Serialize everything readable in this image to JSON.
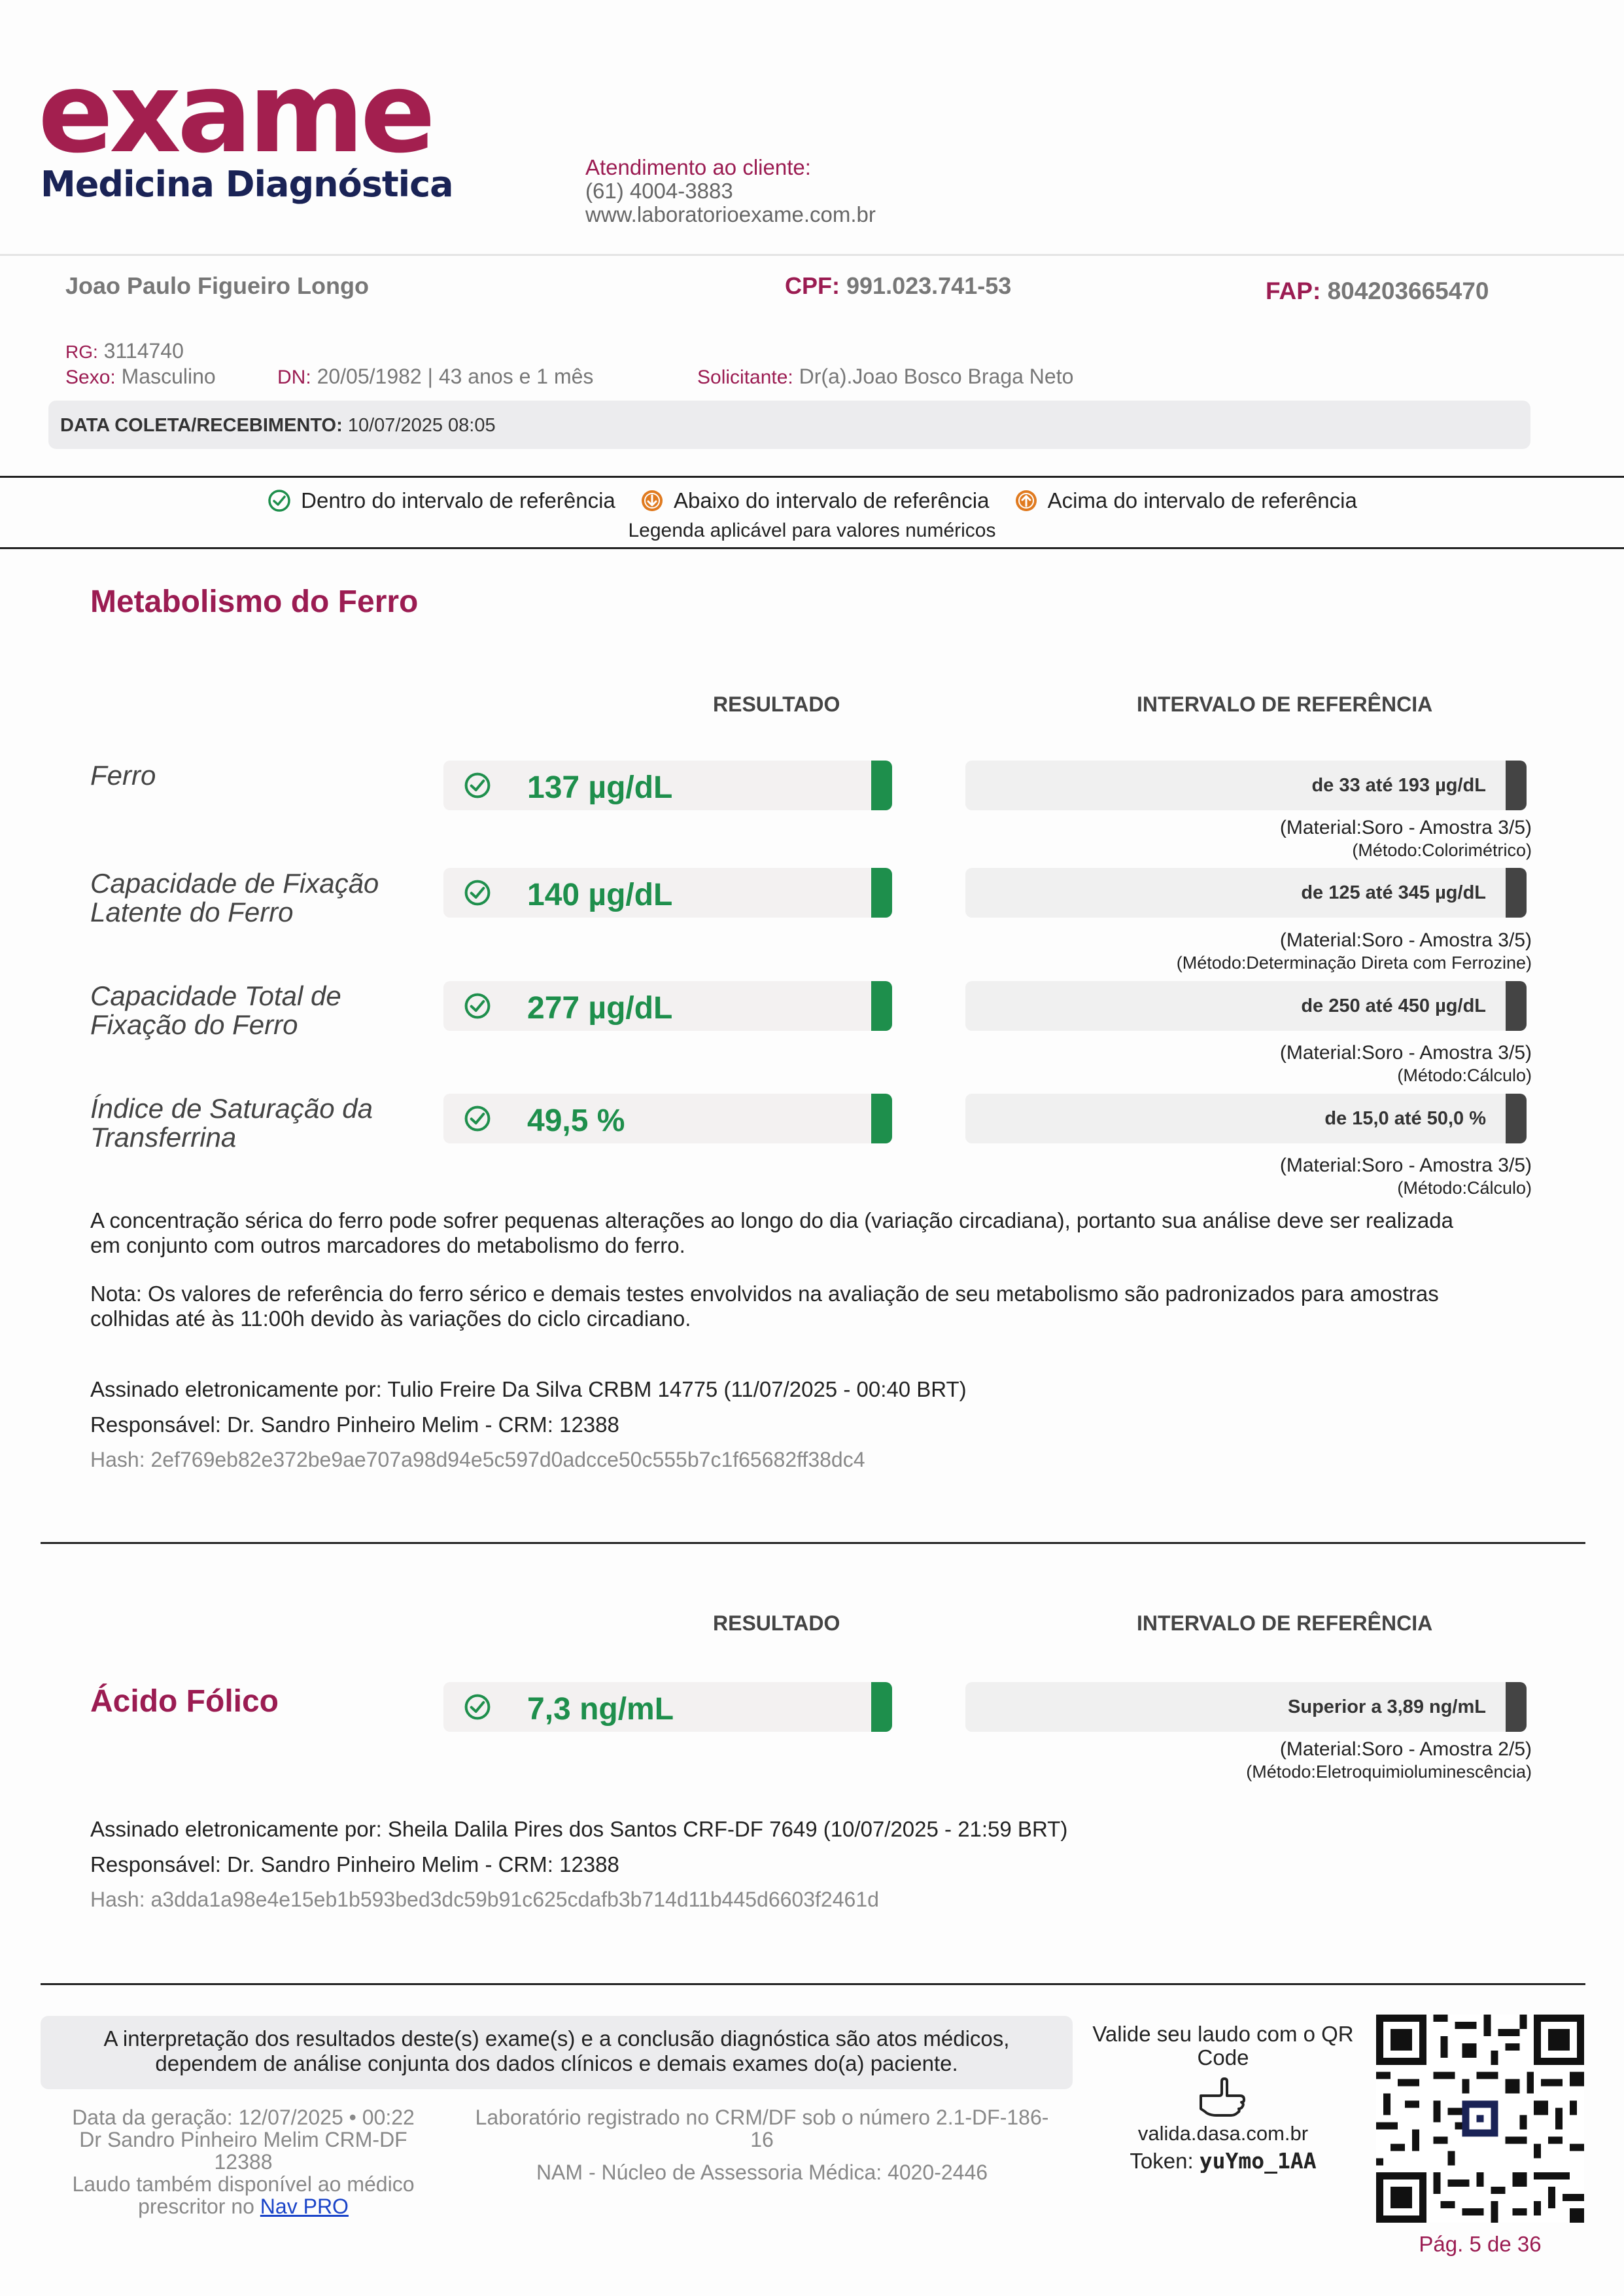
{
  "header": {
    "logo_word": "exame",
    "logo_sub": "Medicina Diagnóstica",
    "contact_label": "Atendimento ao cliente:",
    "contact_phone": "(61) 4004-3883",
    "contact_site": "www.laboratorioexame.com.br"
  },
  "patient": {
    "name": "Joao Paulo Figueiro Longo",
    "cpf_label": "CPF:",
    "cpf": "991.023.741-53",
    "fap_label": "FAP:",
    "fap": "804203665470",
    "rg_label": "RG:",
    "rg": "3114740",
    "sexo_label": "Sexo:",
    "sexo": "Masculino",
    "dn_label": "DN:",
    "dn": "20/05/1982 | 43 anos e 1 mês",
    "solicitante_label": "Solicitante:",
    "solicitante": "Dr(a).Joao Bosco Braga Neto",
    "coleta_label": "DATA COLETA/RECEBIMENTO:",
    "coleta": "10/07/2025 08:05"
  },
  "legend": {
    "within": "Dentro do intervalo de referência",
    "below": "Abaixo do intervalo de referência",
    "above": "Acima do intervalo de referência",
    "note": "Legenda aplicável para valores numéricos",
    "colors": {
      "within": "#1e8f4c",
      "below": "#e07a1f",
      "above": "#e07a1f"
    }
  },
  "columns": {
    "result": "RESULTADO",
    "reference": "INTERVALO DE REFERÊNCIA"
  },
  "iron": {
    "title": "Metabolismo do Ferro",
    "exams": [
      {
        "name_l1": "Ferro",
        "name_l2": "",
        "result": "137 µg/dL",
        "ref": "de 33 até 193 µg/dL",
        "material": "(Material:Soro - Amostra 3/5)",
        "method": "(Método:Colorimétrico)",
        "status": "within"
      },
      {
        "name_l1": "Capacidade de Fixação",
        "name_l2": "Latente do Ferro",
        "result": "140 µg/dL",
        "ref": "de 125 até 345 µg/dL",
        "material": "(Material:Soro - Amostra 3/5)",
        "method": "(Método:Determinação Direta com Ferrozine)",
        "status": "within"
      },
      {
        "name_l1": "Capacidade Total de",
        "name_l2": "Fixação do Ferro",
        "result": "277 µg/dL",
        "ref": "de 250 até 450 µg/dL",
        "material": "(Material:Soro - Amostra 3/5)",
        "method": "(Método:Cálculo)",
        "status": "within"
      },
      {
        "name_l1": "Índice de Saturação da",
        "name_l2": "Transferrina",
        "result": "49,5 %",
        "ref": "de 15,0 até 50,0 %",
        "material": "(Material:Soro - Amostra 3/5)",
        "method": "(Método:Cálculo)",
        "status": "within"
      }
    ],
    "para1_l1": "A concentração sérica do ferro pode sofrer pequenas alterações ao longo do dia (variação circadiana), portanto sua análise deve ser realizada",
    "para1_l2": "em conjunto com outros marcadores do metabolismo do ferro.",
    "para2_l1": "Nota: Os valores de referência do ferro sérico e demais testes envolvidos na avaliação de seu metabolismo são padronizados para amostras",
    "para2_l2": "colhidas até às 11:00h devido às variações do ciclo circadiano.",
    "signed": "Assinado eletronicamente por: Tulio Freire Da Silva CRBM 14775 (11/07/2025 - 00:40 BRT)",
    "responsible": "Responsável: Dr. Sandro Pinheiro Melim - CRM: 12388",
    "hash": "Hash: 2ef769eb82e372be9ae707a98d94e5c597d0adcce50c555b7c1f65682ff38dc4"
  },
  "folic": {
    "title": "Ácido Fólico",
    "result": "7,3 ng/mL",
    "ref": "Superior a 3,89 ng/mL",
    "material": "(Material:Soro - Amostra 2/5)",
    "method": "(Método:Eletroquimioluminescência)",
    "status": "within",
    "signed": "Assinado eletronicamente por: Sheila Dalila Pires dos Santos CRF-DF 7649 (10/07/2025 - 21:59 BRT)",
    "responsible": "Responsável: Dr. Sandro Pinheiro Melim - CRM: 12388",
    "hash": "Hash: a3dda1a98e4e15eb1b593bed3dc59b91c625cdafb3b714d11b445d6603f2461d"
  },
  "footer": {
    "notice_l1": "A interpretação dos resultados deste(s) exame(s) e a conclusão diagnóstica são atos médicos,",
    "notice_l2": "dependem de análise conjunta dos dados clínicos e demais exames do(a) paciente.",
    "gen_l1": "Data da geração: 12/07/2025 • 00:22",
    "gen_l2": "Dr Sandro Pinheiro Melim CRM-DF",
    "gen_l3": "12388",
    "gen_l4": "Laudo também disponível ao médico",
    "gen_l5": "prescritor no",
    "gen_link": "Nav PRO",
    "lab_l1": "Laboratório registrado no CRM/DF sob o número 2.1-DF-186-",
    "lab_l2": "16",
    "lab_l3": "NAM - Núcleo de Assessoria Médica: 4020-2446",
    "valida_l1": "Valide seu laudo com o QR",
    "valida_l2": "Code",
    "valida_site": "valida.dasa.com.br",
    "token_label": "Token:",
    "token": "yuYmo_1AA",
    "page": "Pág. 5 de 36"
  }
}
